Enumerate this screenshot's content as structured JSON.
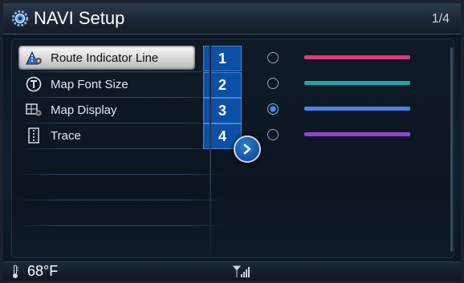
{
  "header": {
    "title": "NAVI Setup",
    "page_indicator": "1/4"
  },
  "menu": {
    "items": [
      {
        "label": "Route Indicator Line",
        "icon": "route-indicator-icon",
        "badge": "1",
        "selected": true
      },
      {
        "label": "Map Font Size",
        "icon": "font-t-icon",
        "badge": "2",
        "selected": false
      },
      {
        "label": "Map Display",
        "icon": "map-display-icon",
        "badge": "3",
        "selected": false
      },
      {
        "label": "Trace",
        "icon": "trace-icon",
        "badge": "4",
        "selected": false
      }
    ]
  },
  "line_options": [
    {
      "color": "#e03a7a",
      "selected": false
    },
    {
      "color": "#1fa7a8",
      "selected": false
    },
    {
      "color": "#4a84e8",
      "selected": true
    },
    {
      "color": "#9a3fd8",
      "selected": false
    }
  ],
  "status": {
    "temperature": "68°F",
    "icons": [
      "thermometer-icon",
      "signal-icon"
    ]
  },
  "colors": {
    "badge_bg": "#0b4fa6",
    "accent": "#2e7cd6"
  }
}
